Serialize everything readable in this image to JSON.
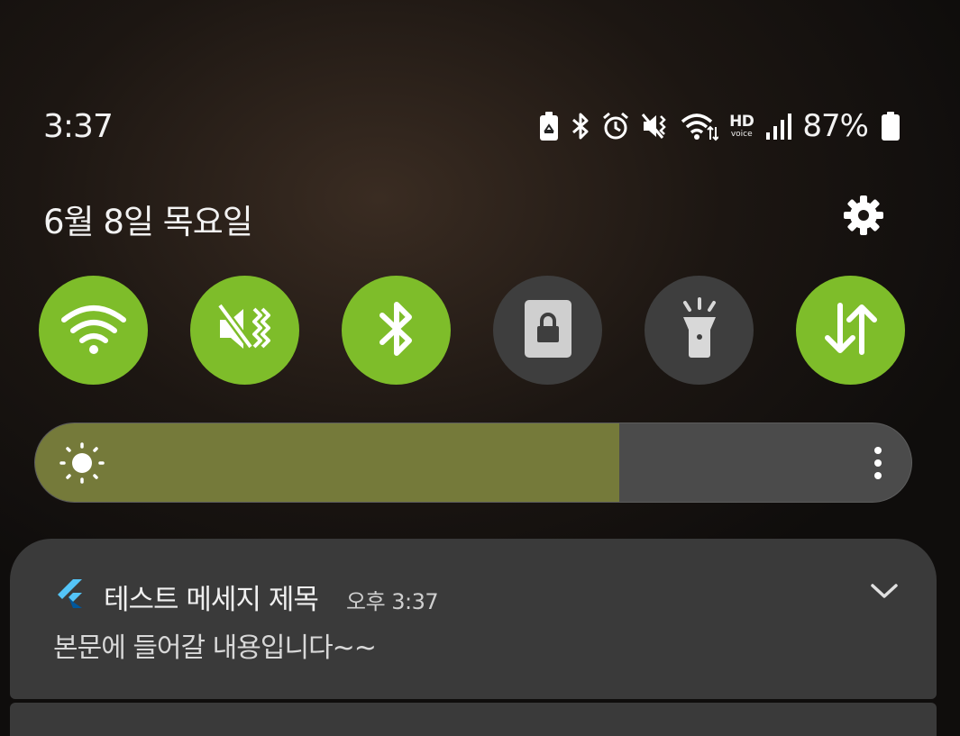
{
  "status_bar": {
    "time": "3:37",
    "icons": [
      "battery-saver-icon",
      "bluetooth-icon",
      "alarm-icon",
      "vibrate-icon",
      "wifi-data-icon",
      "hd-voice-icon",
      "signal-icon",
      "battery-icon"
    ],
    "hd_label": "HD",
    "voice_label": "voice",
    "battery_percent": "87%"
  },
  "header": {
    "date": "6월 8일 목요일"
  },
  "quick_settings": [
    {
      "name": "wifi",
      "icon": "wifi-icon",
      "state": "on"
    },
    {
      "name": "vibrate",
      "icon": "vibrate-icon",
      "state": "on"
    },
    {
      "name": "bluetooth",
      "icon": "bluetooth-icon",
      "state": "on"
    },
    {
      "name": "screen-lock",
      "icon": "lock-rotation-icon",
      "state": "off"
    },
    {
      "name": "flashlight",
      "icon": "flashlight-icon",
      "state": "off"
    },
    {
      "name": "mobile-data",
      "icon": "data-transfer-icon",
      "state": "on"
    }
  ],
  "brightness": {
    "level": 0.667
  },
  "notification": {
    "app_icon": "flutter-icon",
    "title": "테스트 메세지 제목",
    "time": "오후 3:37",
    "body": "본문에 들어갈 내용입니다~~"
  },
  "colors": {
    "accent_on": "#7ebd2a",
    "tile_off": "#3e3e3e",
    "brightness_fill": "#757a3a",
    "notification_bg": "#3a3a3a"
  }
}
